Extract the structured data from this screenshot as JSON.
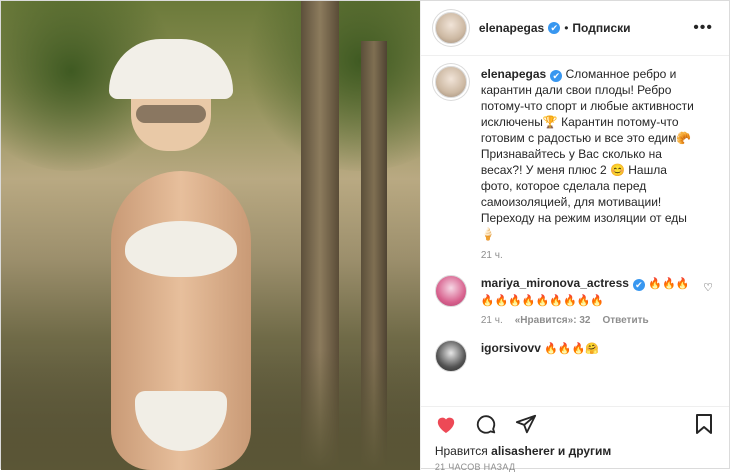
{
  "post": {
    "username": "elenapegas",
    "follow_label": "Подписки",
    "more_label": "•••",
    "verified_glyph": "✔"
  },
  "caption": {
    "username": "elenapegas",
    "text": "Сломанное ребро и карантин дали свои плоды! Ребро потому-что спорт и любые активности исключены🏆 Карантин потому-что готовим с радостью и все это едим🥐 Признавайтесь у Вас сколько на весах?! У меня плюс 2 😊 Нашла фото, которое сделала перед самоизоляцией, для мотивации! Переходу на режим изоляции от еды🍦",
    "time": "21 ч."
  },
  "comments": [
    {
      "username": "mariya_mironova_actress",
      "text": "🔥🔥🔥🔥🔥🔥🔥🔥🔥🔥🔥🔥",
      "time": "21 ч.",
      "likes": "«Нравится»: 32",
      "reply": "Ответить"
    },
    {
      "username": "igorsivovv",
      "text": "🔥🔥🔥🤗"
    }
  ],
  "footer": {
    "likes_prefix": "Нравится",
    "likes_user": "alisasherer",
    "likes_suffix": "и другим",
    "ago": "21 часов назад"
  },
  "icons": {
    "like": "heart-icon",
    "comment": "comment-icon",
    "share": "share-icon",
    "save": "bookmark-icon"
  },
  "colors": {
    "accent": "#3897f0",
    "like_red": "#ed4956"
  }
}
